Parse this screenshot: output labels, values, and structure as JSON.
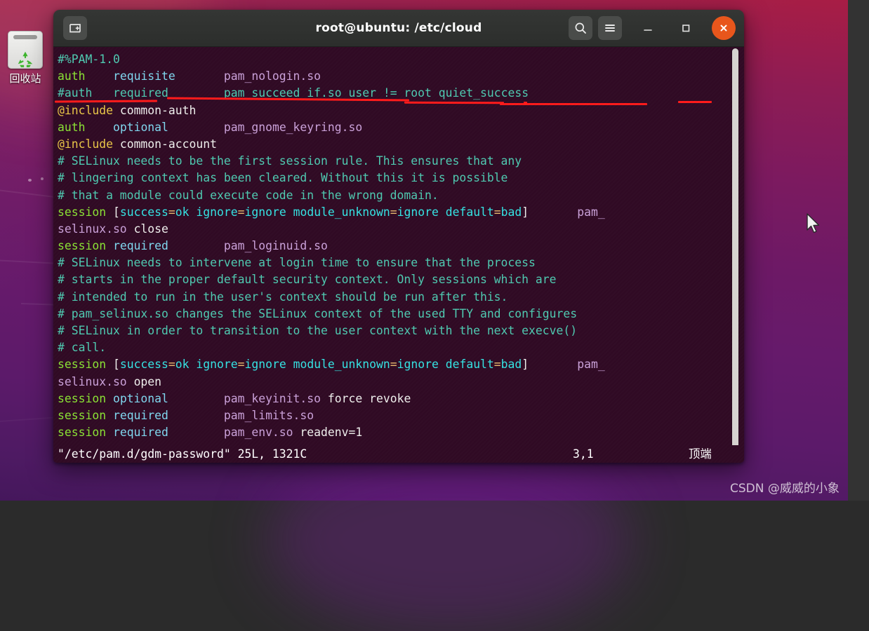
{
  "desktop": {
    "trash": {
      "label": "回收站",
      "icon": "recycle-bin-icon"
    },
    "watermark": "CSDN @威威的小象"
  },
  "window": {
    "title": "root@ubuntu: /etc/cloud",
    "titlebar_buttons": {
      "new_tab": "new-tab-icon",
      "search": "search-icon",
      "menu": "hamburger-menu-icon",
      "minimize": "minimize-icon",
      "maximize": "maximize-icon",
      "close": "close-icon"
    },
    "close_color": "#e8561c"
  },
  "terminal": {
    "background": "#300a24",
    "lines": [
      {
        "segs": [
          {
            "t": "#%PAM-1.0",
            "c": "c-comment"
          }
        ]
      },
      {
        "segs": [
          {
            "t": "auth",
            "c": "c-green"
          },
          {
            "t": "    ",
            "c": "c-white"
          },
          {
            "t": "requisite",
            "c": "c-keyword"
          },
          {
            "t": "       ",
            "c": "c-white"
          },
          {
            "t": "pam_nologin.so",
            "c": "c-mod"
          }
        ]
      },
      {
        "segs": [
          {
            "t": "#auth",
            "c": "c-comment"
          },
          {
            "t": "   ",
            "c": "c-white"
          },
          {
            "t": "required",
            "c": "c-comment"
          },
          {
            "t": "        ",
            "c": "c-white"
          },
          {
            "t": "pam_succeed_if.so",
            "c": "c-comment"
          },
          {
            "t": " user != root quiet_success",
            "c": "c-comment"
          }
        ]
      },
      {
        "segs": [
          {
            "t": "@include",
            "c": "c-yellow"
          },
          {
            "t": " ",
            "c": "c-white"
          },
          {
            "t": "common-auth",
            "c": "c-white"
          }
        ]
      },
      {
        "segs": [
          {
            "t": "auth",
            "c": "c-green"
          },
          {
            "t": "    ",
            "c": "c-white"
          },
          {
            "t": "optional",
            "c": "c-keyword"
          },
          {
            "t": "        ",
            "c": "c-white"
          },
          {
            "t": "pam_gnome_keyring.so",
            "c": "c-mod"
          }
        ]
      },
      {
        "segs": [
          {
            "t": "@include",
            "c": "c-yellow"
          },
          {
            "t": " ",
            "c": "c-white"
          },
          {
            "t": "common-account",
            "c": "c-white"
          }
        ]
      },
      {
        "segs": [
          {
            "t": "# SELinux needs to be the first session rule. This ensures that any",
            "c": "c-comment"
          }
        ]
      },
      {
        "segs": [
          {
            "t": "# lingering context has been cleared. Without this it is possible",
            "c": "c-comment"
          }
        ]
      },
      {
        "segs": [
          {
            "t": "# that a module could execute code in the wrong domain.",
            "c": "c-comment"
          }
        ]
      },
      {
        "segs": [
          {
            "t": "session",
            "c": "c-green"
          },
          {
            "t": " ",
            "c": "c-white"
          },
          {
            "t": "[",
            "c": "c-white"
          },
          {
            "t": "success",
            "c": "c-cyan"
          },
          {
            "t": "=",
            "c": "c-orange"
          },
          {
            "t": "ok",
            "c": "c-cyan"
          },
          {
            "t": " ",
            "c": "c-white"
          },
          {
            "t": "ignore",
            "c": "c-cyan"
          },
          {
            "t": "=",
            "c": "c-orange"
          },
          {
            "t": "ignore",
            "c": "c-cyan"
          },
          {
            "t": " ",
            "c": "c-white"
          },
          {
            "t": "module_unknown",
            "c": "c-cyan"
          },
          {
            "t": "=",
            "c": "c-orange"
          },
          {
            "t": "ignore",
            "c": "c-cyan"
          },
          {
            "t": " ",
            "c": "c-white"
          },
          {
            "t": "default",
            "c": "c-cyan"
          },
          {
            "t": "=",
            "c": "c-orange"
          },
          {
            "t": "bad",
            "c": "c-cyan"
          },
          {
            "t": "]",
            "c": "c-white"
          },
          {
            "t": "       ",
            "c": "c-white"
          },
          {
            "t": "pam_",
            "c": "c-mod"
          }
        ]
      },
      {
        "segs": [
          {
            "t": "selinux.so",
            "c": "c-mod"
          },
          {
            "t": " ",
            "c": "c-white"
          },
          {
            "t": "close",
            "c": "c-white"
          }
        ]
      },
      {
        "segs": [
          {
            "t": "session",
            "c": "c-green"
          },
          {
            "t": " ",
            "c": "c-white"
          },
          {
            "t": "required",
            "c": "c-keyword"
          },
          {
            "t": "        ",
            "c": "c-white"
          },
          {
            "t": "pam_loginuid.so",
            "c": "c-mod"
          }
        ]
      },
      {
        "segs": [
          {
            "t": "# SELinux needs to intervene at login time to ensure that the process",
            "c": "c-comment"
          }
        ]
      },
      {
        "segs": [
          {
            "t": "# starts in the proper default security context. Only sessions which are",
            "c": "c-comment"
          }
        ]
      },
      {
        "segs": [
          {
            "t": "# intended to run in the user's context should be run after this.",
            "c": "c-comment"
          }
        ]
      },
      {
        "segs": [
          {
            "t": "# pam_selinux.so changes the SELinux context of the used TTY and configures",
            "c": "c-comment"
          }
        ]
      },
      {
        "segs": [
          {
            "t": "# SELinux in order to transition to the user context with the next execve()",
            "c": "c-comment"
          }
        ]
      },
      {
        "segs": [
          {
            "t": "# call.",
            "c": "c-comment"
          }
        ]
      },
      {
        "segs": [
          {
            "t": "session",
            "c": "c-green"
          },
          {
            "t": " ",
            "c": "c-white"
          },
          {
            "t": "[",
            "c": "c-white"
          },
          {
            "t": "success",
            "c": "c-cyan"
          },
          {
            "t": "=",
            "c": "c-orange"
          },
          {
            "t": "ok",
            "c": "c-cyan"
          },
          {
            "t": " ",
            "c": "c-white"
          },
          {
            "t": "ignore",
            "c": "c-cyan"
          },
          {
            "t": "=",
            "c": "c-orange"
          },
          {
            "t": "ignore",
            "c": "c-cyan"
          },
          {
            "t": " ",
            "c": "c-white"
          },
          {
            "t": "module_unknown",
            "c": "c-cyan"
          },
          {
            "t": "=",
            "c": "c-orange"
          },
          {
            "t": "ignore",
            "c": "c-cyan"
          },
          {
            "t": " ",
            "c": "c-white"
          },
          {
            "t": "default",
            "c": "c-cyan"
          },
          {
            "t": "=",
            "c": "c-orange"
          },
          {
            "t": "bad",
            "c": "c-cyan"
          },
          {
            "t": "]",
            "c": "c-white"
          },
          {
            "t": "       ",
            "c": "c-white"
          },
          {
            "t": "pam_",
            "c": "c-mod"
          }
        ]
      },
      {
        "segs": [
          {
            "t": "selinux.so",
            "c": "c-mod"
          },
          {
            "t": " ",
            "c": "c-white"
          },
          {
            "t": "open",
            "c": "c-white"
          }
        ]
      },
      {
        "segs": [
          {
            "t": "session",
            "c": "c-green"
          },
          {
            "t": " ",
            "c": "c-white"
          },
          {
            "t": "optional",
            "c": "c-keyword"
          },
          {
            "t": "        ",
            "c": "c-white"
          },
          {
            "t": "pam_keyinit.so",
            "c": "c-mod"
          },
          {
            "t": " ",
            "c": "c-white"
          },
          {
            "t": "force revoke",
            "c": "c-white"
          }
        ]
      },
      {
        "segs": [
          {
            "t": "session",
            "c": "c-green"
          },
          {
            "t": " ",
            "c": "c-white"
          },
          {
            "t": "required",
            "c": "c-keyword"
          },
          {
            "t": "        ",
            "c": "c-white"
          },
          {
            "t": "pam_limits.so",
            "c": "c-mod"
          }
        ]
      },
      {
        "segs": [
          {
            "t": "session",
            "c": "c-green"
          },
          {
            "t": " ",
            "c": "c-white"
          },
          {
            "t": "required",
            "c": "c-keyword"
          },
          {
            "t": "        ",
            "c": "c-white"
          },
          {
            "t": "pam_env.so",
            "c": "c-mod"
          },
          {
            "t": " ",
            "c": "c-white"
          },
          {
            "t": "readenv=1",
            "c": "c-white"
          }
        ]
      }
    ],
    "status": {
      "file": "\"/etc/pam.d/gdm-password\" 25L, 1321C",
      "position": "3,1",
      "scroll_state": "顶端"
    },
    "annotation_color": "#ff1a1a"
  }
}
